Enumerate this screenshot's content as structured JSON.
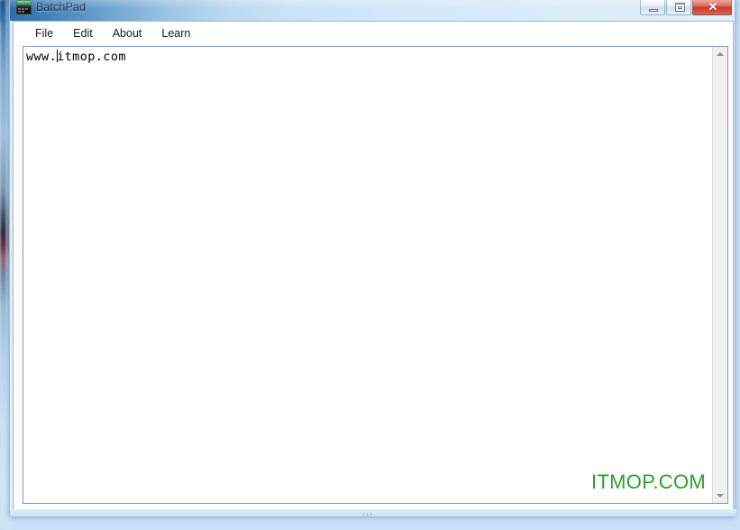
{
  "window": {
    "title": "BatchPad",
    "app_icon": "batch-console-icon",
    "controls": {
      "minimize_label": "─",
      "maximize_label": "□",
      "close_label": "✕"
    }
  },
  "menubar": {
    "items": [
      {
        "label": "File",
        "name": "menu-item-file"
      },
      {
        "label": "Edit",
        "name": "menu-item-edit"
      },
      {
        "label": "About",
        "name": "menu-item-about"
      },
      {
        "label": "Learn",
        "name": "menu-item-learn"
      }
    ]
  },
  "editor": {
    "text_before_caret": "www.",
    "text_after_caret": "itmop.com",
    "placeholder": "",
    "full_text": "www.itmop.com"
  },
  "scrollbar": {
    "up_arrow": "▲",
    "down_arrow": "▼"
  },
  "watermark": {
    "text": "ITMOP.COM",
    "color": "#2f9e2f"
  },
  "colors": {
    "titlebar_start": "#2f6ea8",
    "titlebar_end": "#e2f1fc",
    "close_button": "#c23a2c",
    "client_background": "#ffffff",
    "desktop_background": "#c9e0f7"
  }
}
